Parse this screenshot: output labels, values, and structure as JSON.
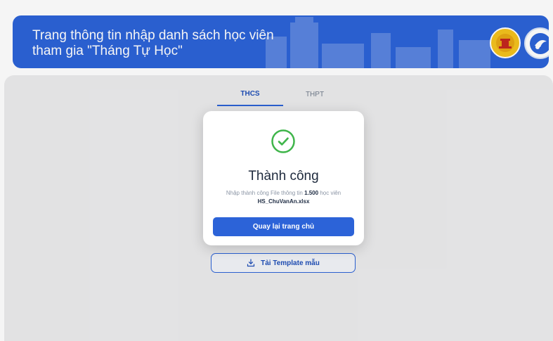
{
  "header": {
    "title_line1": "Trang thông tin nhập danh sách học viên",
    "title_line2": "tham gia \"Tháng Tự Học\"",
    "logo_left_icon": "hanoi-emblem-icon",
    "logo_right_icon": "education-logo-icon",
    "background_color": "#2c63d8"
  },
  "tabs": [
    {
      "label": "THCS",
      "active": true
    },
    {
      "label": "THPT",
      "active": false
    }
  ],
  "download": {
    "label": "Tải Template mẫu",
    "icon": "download-icon"
  },
  "modal": {
    "icon": "success-check-icon",
    "title": "Thành công",
    "desc_prefix": "Nhập thành công File thông tin ",
    "count": "1.500",
    "desc_suffix": " học viên",
    "file_name": "HS_ChuVanAn.xlsx",
    "button_label": "Quay lại trang chủ",
    "accent_color": "#2c63d8",
    "success_color": "#3fb54a"
  }
}
